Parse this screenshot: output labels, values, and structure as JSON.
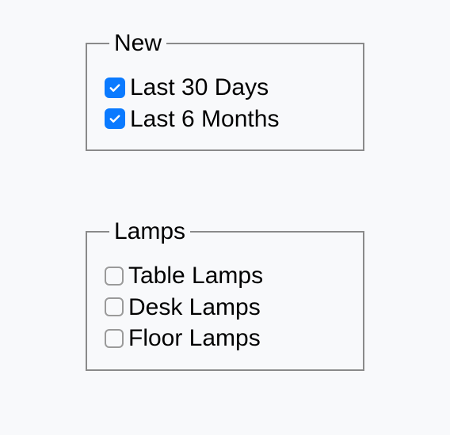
{
  "groups": {
    "new": {
      "legend": "New",
      "options": [
        {
          "label": "Last 30 Days",
          "checked": true
        },
        {
          "label": "Last 6 Months",
          "checked": true
        }
      ]
    },
    "lamps": {
      "legend": "Lamps",
      "options": [
        {
          "label": "Table Lamps",
          "checked": false
        },
        {
          "label": "Desk Lamps",
          "checked": false
        },
        {
          "label": "Floor Lamps",
          "checked": false
        }
      ]
    }
  }
}
